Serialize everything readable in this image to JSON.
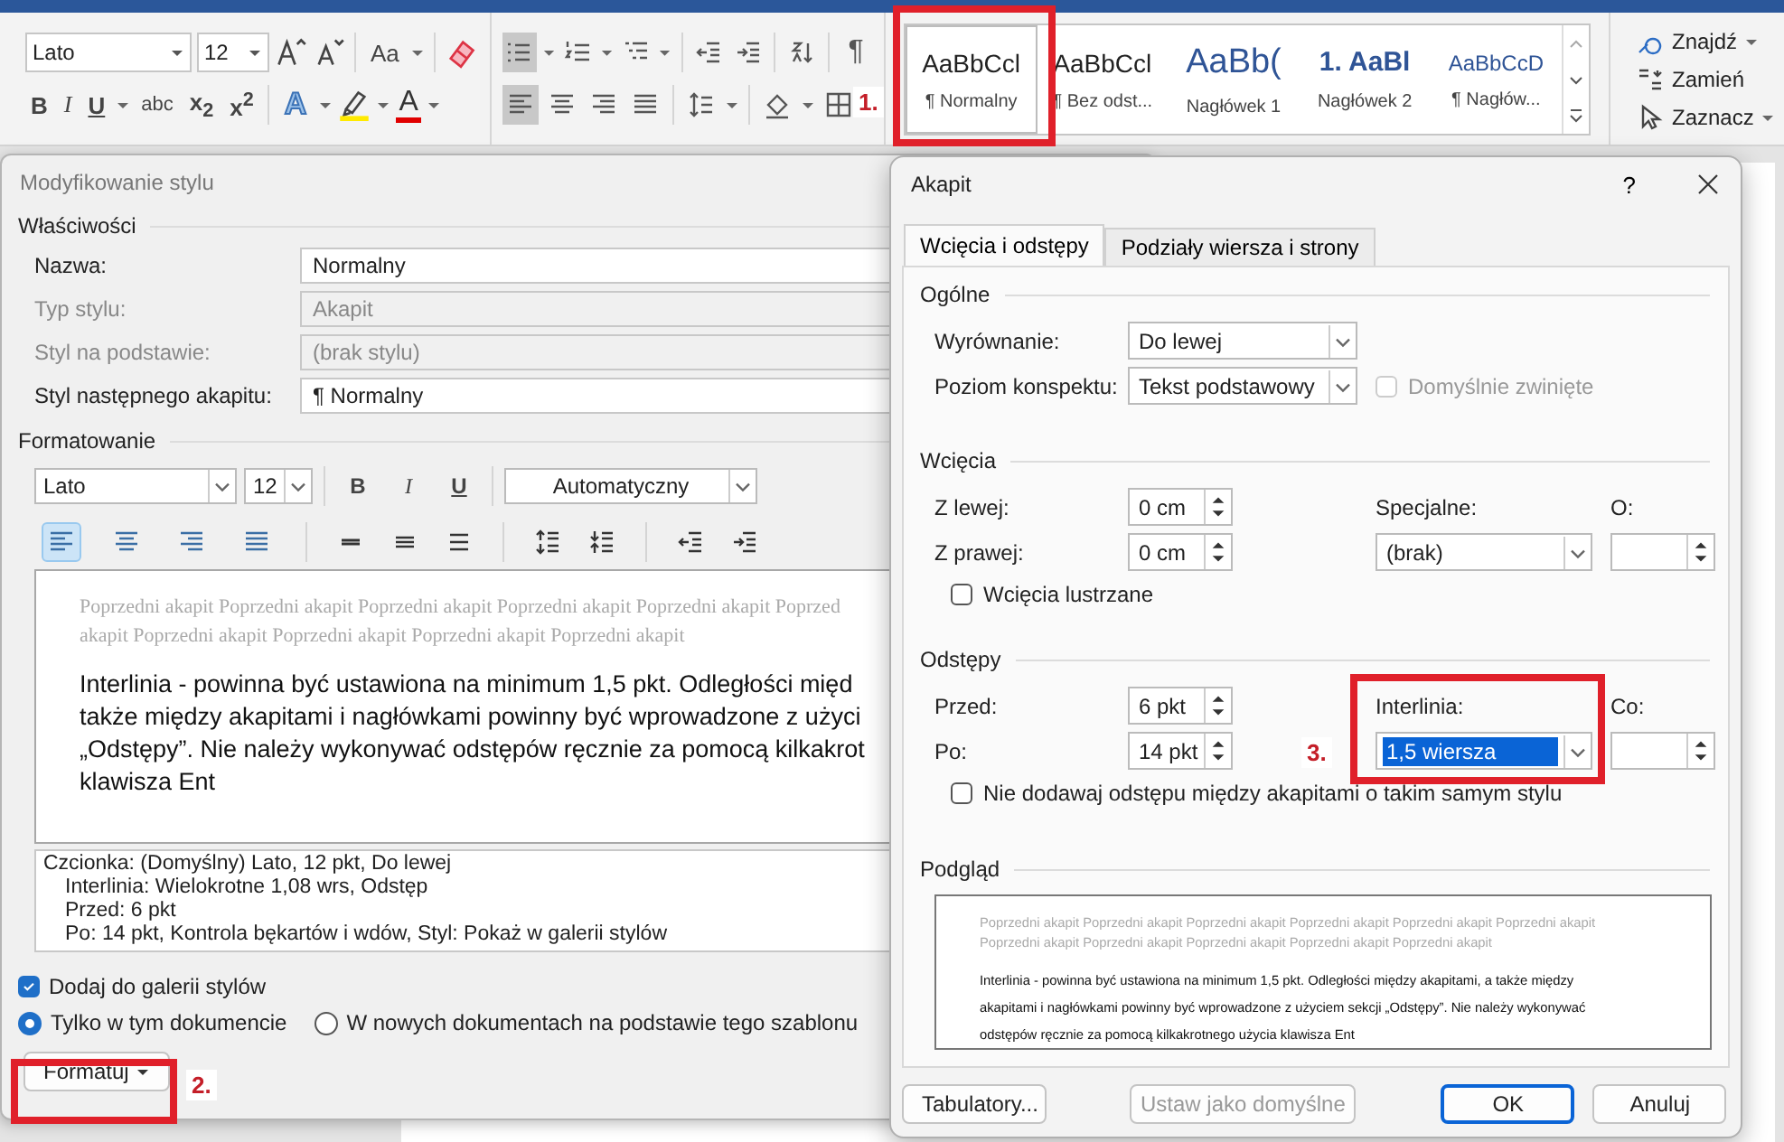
{
  "ribbon": {
    "font": {
      "name": "Lato",
      "size": "12"
    },
    "change_case": "Aa",
    "font_buttons": [
      {
        "kind": "bold",
        "label": "B",
        "menu": false
      },
      {
        "kind": "italic",
        "label": "I",
        "menu": false
      },
      {
        "kind": "underline",
        "label": "U",
        "menu": true
      },
      {
        "kind": "strike",
        "label": "abc",
        "menu": false
      },
      {
        "kind": "subscript",
        "label": "x$_{2}$",
        "menu": false
      },
      {
        "kind": "superscript",
        "label": "x$^{2}$",
        "menu": false
      },
      {
        "kind": "effects",
        "label": "A",
        "menu": true
      },
      {
        "kind": "highlight",
        "menu": true
      },
      {
        "kind": "color",
        "label": "A",
        "menu": true
      }
    ],
    "paragraph_row1": [
      [
        {
          "kind": "bullets",
          "selected": true,
          "menu": true
        },
        {
          "kind": "numbering",
          "selected": false,
          "menu": true
        },
        {
          "kind": "multilevel",
          "selected": false,
          "menu": true
        }
      ],
      [
        {
          "kind": "outdent",
          "selected": false,
          "menu": false
        },
        {
          "kind": "indent",
          "selected": false,
          "menu": false
        }
      ],
      [
        {
          "kind": "sort",
          "selected": false,
          "menu": false
        }
      ],
      [
        {
          "kind": "marks",
          "label": "¶",
          "selected": false,
          "menu": false
        }
      ]
    ],
    "paragraph_row2": [
      [
        {
          "kind": "left",
          "selected": true,
          "menu": false
        },
        {
          "kind": "center",
          "selected": false,
          "menu": false
        },
        {
          "kind": "right",
          "selected": false,
          "menu": false
        },
        {
          "kind": "justify",
          "selected": false,
          "menu": false
        }
      ],
      [
        {
          "kind": "linespacing",
          "selected": false,
          "menu": true
        }
      ],
      [
        {
          "kind": "shading",
          "selected": false,
          "menu": true
        },
        {
          "kind": "borders",
          "selected": false,
          "menu": false
        }
      ]
    ],
    "styles": [
      {
        "kind": "normal",
        "preview": "AaBbCcl",
        "name": "¶ Normalny",
        "selected": true
      },
      {
        "kind": "normal",
        "preview": "AaBbCcl",
        "name": "¶ Bez odst...",
        "selected": false
      },
      {
        "kind": "heading1",
        "preview": "AaBb(",
        "name": "Nagłówek 1",
        "selected": false
      },
      {
        "kind": "heading2",
        "preview": "1. AaBl",
        "name": "Nagłówek 2",
        "selected": false
      },
      {
        "kind": "heading3",
        "preview": "AaBbCcD",
        "name": "¶ Nagłów...",
        "selected": false
      }
    ],
    "editing": [
      {
        "kind": "find",
        "label": "Znajdź",
        "menu": true
      },
      {
        "kind": "replace",
        "label": "Zamień",
        "menu": false
      },
      {
        "kind": "select",
        "label": "Zaznacz",
        "menu": true
      }
    ]
  },
  "annotations": [
    "1.",
    "2.",
    "3."
  ],
  "modify_dialog": {
    "title": "Modyfikowanie stylu",
    "properties_heading": "Właściwości",
    "properties": [
      {
        "label": "Nazwa:",
        "value": "Normalny",
        "disabled": false
      },
      {
        "label": "Typ stylu:",
        "value": "Akapit",
        "disabled": true
      },
      {
        "label": "Styl na podstawie:",
        "value": "(brak stylu)",
        "disabled": true
      },
      {
        "label": "Styl następnego akapitu:",
        "value": "¶ Normalny",
        "disabled": false
      }
    ],
    "formatting_heading": "Formatowanie",
    "font": "Lato",
    "size": "12",
    "text_buttons": [
      "B",
      "I",
      "U"
    ],
    "color_setting": "Automatyczny",
    "align_buttons": [
      {
        "kind": "left",
        "selected": true
      },
      {
        "kind": "center",
        "selected": false
      },
      {
        "kind": "right",
        "selected": false
      },
      {
        "kind": "justify",
        "selected": false
      }
    ],
    "preview_previous": [
      "Poprzedni akapit Poprzedni akapit Poprzedni akapit Poprzedni akapit Poprzedni akapit Poprzed",
      "akapit Poprzedni akapit Poprzedni akapit Poprzedni akapit Poprzedni akapit"
    ],
    "preview_sample": [
      "Interlinia - powinna być ustawiona na minimum 1,5 pkt. Odległości międ",
      "także między akapitami i nagłówkami powinny być wprowadzone z użyci",
      "„Odstępy”. Nie należy wykonywać odstępów ręcznie za pomocą kilkakrot",
      "klawisza Ent"
    ],
    "description": [
      "Czcionka: (Domyślny) Lato, 12 pkt, Do lewej",
      "Interlinia:  Wielokrotne 1,08 wrs, Odstęp",
      "Przed:  6 pkt",
      "Po:  14 pkt, Kontrola bękartów i wdów, Styl: Pokaż w galerii stylów"
    ],
    "add_to_gallery": {
      "label": "Dodaj do galerii stylów",
      "checked": true
    },
    "scope": [
      {
        "label": "Tylko w tym dokumencie",
        "selected": true
      },
      {
        "label": "W nowych dokumentach na podstawie tego szablonu",
        "selected": false
      }
    ],
    "format_button": "Formatuj"
  },
  "paragraph_dialog": {
    "title": "Akapit",
    "help": "?",
    "tabs": [
      {
        "label": "Wcięcia i odstępy",
        "selected": true
      },
      {
        "label": "Podziały wiersza i strony",
        "selected": false
      }
    ],
    "general": {
      "heading": "Ogólne",
      "alignment": {
        "label": "Wyrównanie:",
        "value": "Do lewej"
      },
      "outline": {
        "label": "Poziom konspektu:",
        "value": "Tekst podstawowy"
      },
      "collapsed": {
        "label": "Domyślnie zwinięte",
        "checked": false,
        "disabled": true
      }
    },
    "indents": {
      "heading": "Wcięcia",
      "left": {
        "label": "Z lewej:",
        "value": "0 cm"
      },
      "right": {
        "label": "Z prawej:",
        "value": "0 cm"
      },
      "special": {
        "label": "Specjalne:",
        "value": "(brak)"
      },
      "by": {
        "label": "O:"
      },
      "mirror": {
        "label": "Wcięcia lustrzane",
        "checked": false
      }
    },
    "spacing": {
      "heading": "Odstępy",
      "before": {
        "label": "Przed:",
        "value": "6 pkt"
      },
      "after": {
        "label": "Po:",
        "value": "14 pkt"
      },
      "line": {
        "label": "Interlinia:",
        "value": "1,5 wiersza",
        "selected": true
      },
      "at": {
        "label": "Co:"
      },
      "no_space": {
        "label": "Nie dodawaj odstępu między akapitami o takim samym stylu",
        "checked": false
      }
    },
    "preview": {
      "heading": "Podgląd",
      "previous": [
        "Poprzedni akapit Poprzedni akapit Poprzedni akapit Poprzedni akapit Poprzedni akapit Poprzedni akapit",
        "Poprzedni akapit Poprzedni akapit Poprzedni akapit Poprzedni akapit Poprzedni akapit"
      ],
      "sample": [
        "Interlinia - powinna być ustawiona na minimum 1,5 pkt. Odległości między akapitami, a także między",
        "akapitami i nagłówkami powinny być wprowadzone z użyciem sekcji „Odstępy”. Nie należy wykonywać",
        "odstępów ręcznie za pomocą kilkakrotnego użycia klawisza Ent"
      ]
    },
    "buttons": [
      {
        "label": "Tabulatory...",
        "disabled": false,
        "default": false
      },
      {
        "label": "Ustaw jako domyślne",
        "disabled": true,
        "default": false
      },
      {
        "label": "OK",
        "disabled": false,
        "default": true
      },
      {
        "label": "Anuluj",
        "disabled": false,
        "default": false
      }
    ]
  }
}
